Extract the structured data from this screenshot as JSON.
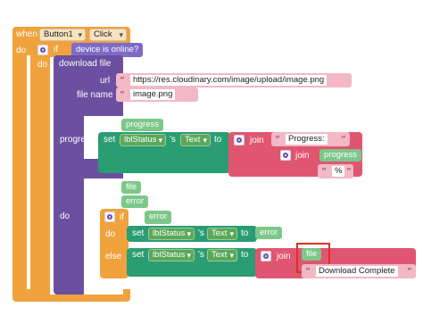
{
  "event": {
    "when": "when",
    "component": "Button1",
    "event": "Click",
    "do": "do"
  },
  "if_block": {
    "keyword": "if",
    "condition": "device is online?",
    "do": "do"
  },
  "download": {
    "title": "download file",
    "url_label": "url",
    "url_value": "https://res.cloudinary.com/image/upload/image.png",
    "filename_label": "file name",
    "filename_value": "image.png",
    "progress_label": "progress",
    "progress_param": "progress",
    "do_label": "do",
    "file_param": "file",
    "error_param": "error"
  },
  "progress_set": {
    "set": "set",
    "component": "lblStatus",
    "possessive": "'s",
    "property": "Text",
    "to": "to",
    "join": "join",
    "text1": "Progress: ",
    "arg": "progress",
    "text2": "%"
  },
  "inner_if": {
    "keyword": "if",
    "condition": "error",
    "do": "do",
    "else": "else"
  },
  "set_error": {
    "set": "set",
    "component": "lblStatus",
    "possessive": "'s",
    "property": "Text",
    "to": "to",
    "value": "error"
  },
  "set_else": {
    "set": "set",
    "component": "lblStatus",
    "possessive": "'s",
    "property": "Text",
    "to": "to",
    "join": "join",
    "arg": "file",
    "text": "Download Complete"
  },
  "colors": {
    "event": "#f0a23c",
    "control": "#5b80a5",
    "download": "#6b4fa0",
    "setter": "#2a9d73",
    "text": "#e05670",
    "var": "#7cc88a",
    "highlight": "#d93025"
  }
}
